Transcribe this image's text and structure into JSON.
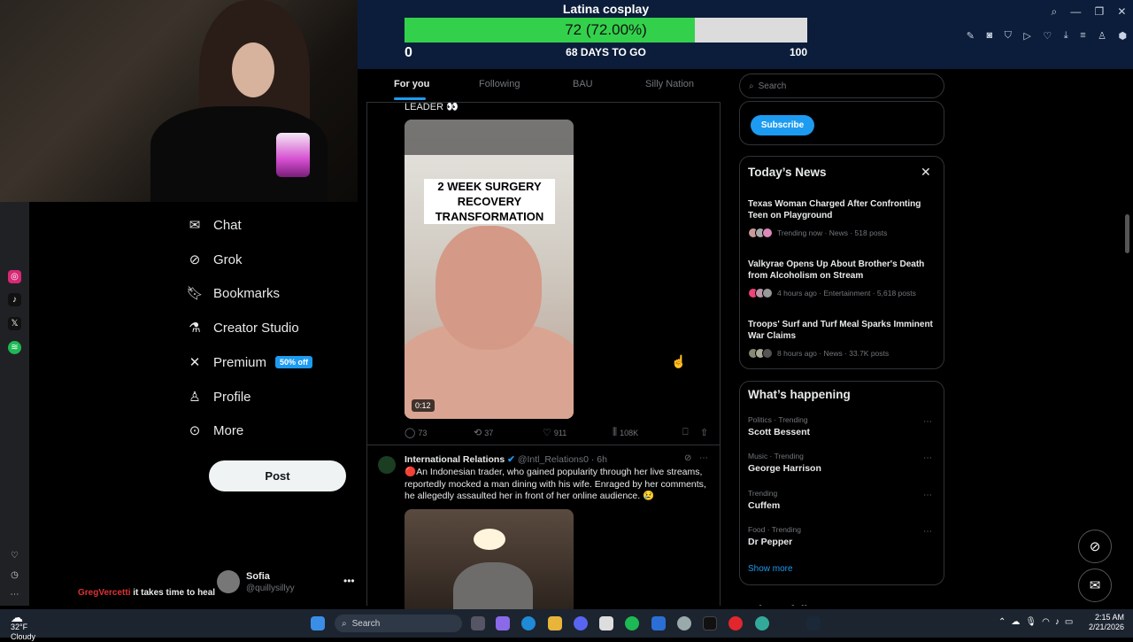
{
  "goal": {
    "title": "Latina cosplay",
    "value_text": "72 (72.00%)",
    "progress": 0.72,
    "min": "0",
    "days": "68 DAYS TO GO",
    "max": "100"
  },
  "nav": {
    "items": [
      {
        "label": "Chat",
        "icon": "mail-icon"
      },
      {
        "label": "Grok",
        "icon": "grok-icon"
      },
      {
        "label": "Bookmarks",
        "icon": "bookmark-icon"
      },
      {
        "label": "Creator Studio",
        "icon": "flask-icon"
      },
      {
        "label": "Premium",
        "icon": "x-logo-icon"
      },
      {
        "label": "Profile",
        "icon": "person-icon"
      },
      {
        "label": "More",
        "icon": "more-circle-icon"
      }
    ],
    "premium_badge": "50% off",
    "post_button": "Post"
  },
  "profile": {
    "name": "Sofia",
    "handle": "@quillysillyy"
  },
  "chat_overlay": {
    "user": "GregVercetti",
    "message": "it takes time to heal"
  },
  "feed": {
    "tabs": [
      {
        "label": "For you",
        "active": true
      },
      {
        "label": "Following",
        "active": false
      },
      {
        "label": "BAU",
        "active": false
      },
      {
        "label": "Silly Nation",
        "active": false
      }
    ],
    "post1": {
      "text_top": "LEADER 👀",
      "video_overlay": [
        "2 WEEK SURGERY",
        "RECOVERY",
        "TRANSFORMATION"
      ],
      "duration": "0:12",
      "replies": "73",
      "reposts": "37",
      "likes": "911",
      "views": "108K"
    },
    "post2": {
      "author": "International Relations",
      "handle": "@Intl_Relations0 · 6h",
      "text": "🔴An Indonesian trader, who gained popularity through her live streams, reportedly mocked a man dining with his wife. Enraged by her comments, he allegedly assaulted her in front of her online audience. 😢"
    }
  },
  "sidebar": {
    "search_placeholder": "Search",
    "subscribe": "Subscribe",
    "news_title": "Today’s News",
    "news": [
      {
        "headline": "Texas Woman Charged After Confronting Teen on Playground",
        "meta": "Trending now · News · 518 posts"
      },
      {
        "headline": "Valkyrae Opens Up About Brother's Death from Alcoholism on Stream",
        "meta": "4 hours ago · Entertainment · 5,618 posts"
      },
      {
        "headline": "Troops' Surf and Turf Meal Sparks Imminent War Claims",
        "meta": "8 hours ago · News · 33.7K posts"
      }
    ],
    "happening_title": "What’s happening",
    "trends": [
      {
        "category": "Politics · Trending",
        "name": "Scott Bessent"
      },
      {
        "category": "Music · Trending",
        "name": "George Harrison"
      },
      {
        "category": "Trending",
        "name": "Cuffem"
      },
      {
        "category": "Food · Trending",
        "name": "Dr Pepper"
      }
    ],
    "show_more": "Show more",
    "who_to_follow": "Who to follow"
  },
  "taskbar": {
    "temp": "32°F",
    "weather": "Cloudy",
    "search": "Search",
    "time": "2:15 AM",
    "date": "2/21/2026"
  }
}
